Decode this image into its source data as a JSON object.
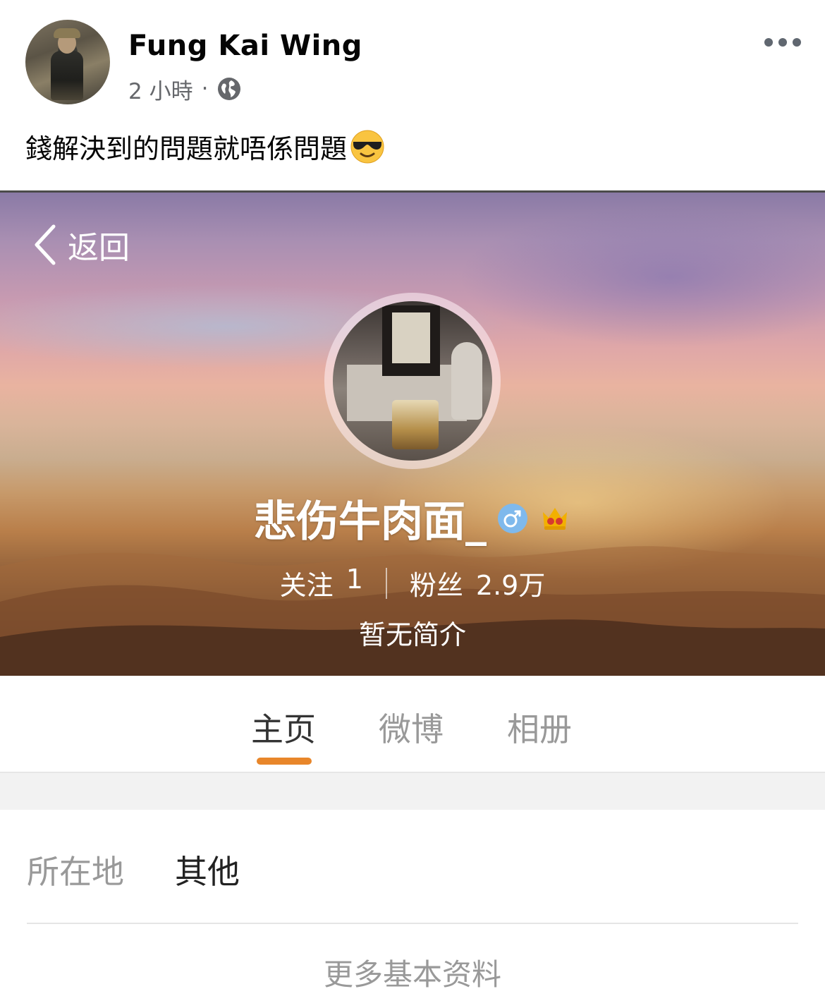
{
  "post": {
    "author": "Fung Kai Wing",
    "time": "2 小時",
    "meta_separator": "·",
    "privacy_icon": "globe-icon",
    "text": "錢解決到的問題就唔係問題",
    "emoji": "smiling-face-with-sunglasses"
  },
  "weibo": {
    "back_label": "返回",
    "name": "悲伤牛肉面_",
    "gender": "♂",
    "badge_icon": "crown-icon",
    "following_label": "关注",
    "following_count": "1",
    "followers_label": "粉丝",
    "followers_count": "2.9万",
    "bio": "暂无简介",
    "tabs": [
      {
        "label": "主页",
        "active": true
      },
      {
        "label": "微博",
        "active": false
      },
      {
        "label": "相册",
        "active": false
      }
    ],
    "location_label": "所在地",
    "location_value": "其他",
    "more_info": "更多基本资料"
  },
  "colors": {
    "tab_underline": "#e8862a",
    "gender_badge": "#7fb9ec",
    "crown": "#f2b000"
  }
}
